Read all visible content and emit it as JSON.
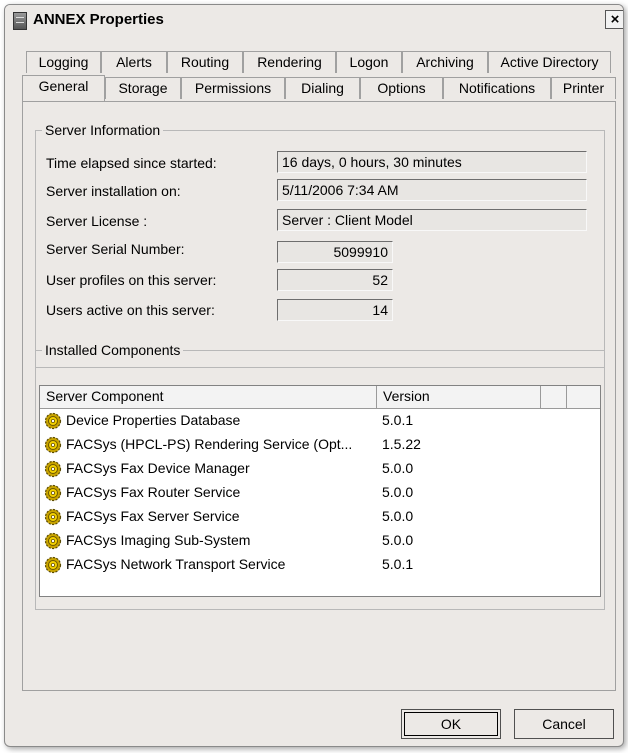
{
  "window": {
    "title": "ANNEX Properties",
    "close_glyph": "×"
  },
  "tabs_row1": [
    "Logging",
    "Alerts",
    "Routing",
    "Rendering",
    "Logon",
    "Archiving",
    "Active Directory"
  ],
  "tabs_row2": [
    "General",
    "Storage",
    "Permissions",
    "Dialing",
    "Options",
    "Notifications",
    "Printer"
  ],
  "active_tab": "General",
  "server_info": {
    "title": "Server Information",
    "time_elapsed_label": "Time elapsed since started:",
    "time_elapsed_value": "16 days, 0 hours, 30 minutes",
    "installation_label": "Server installation on:",
    "installation_value": "5/11/2006 7:34 AM",
    "license_label": "Server License :",
    "license_value": "Server : Client Model",
    "serial_label": "Server Serial Number:",
    "serial_value": "5099910",
    "profiles_label": "User profiles on this server:",
    "profiles_value": "52",
    "active_label": "Users active on this server:",
    "active_value": "14"
  },
  "components": {
    "title": "Installed Components",
    "col_component": "Server Component",
    "col_version": "Version",
    "rows": [
      {
        "name": "Device Properties Database",
        "version": "5.0.1",
        "icon": "gear-icon"
      },
      {
        "name": "FACSys (HPCL-PS) Rendering Service (Opt...",
        "version": "1.5.22",
        "icon": "gear-icon"
      },
      {
        "name": "FACSys Fax Device Manager",
        "version": "5.0.0",
        "icon": "gear-icon"
      },
      {
        "name": "FACSys Fax Router Service",
        "version": "5.0.0",
        "icon": "gear-icon"
      },
      {
        "name": "FACSys Fax Server Service",
        "version": "5.0.0",
        "icon": "gear-icon"
      },
      {
        "name": "FACSys Imaging Sub-System",
        "version": "5.0.0",
        "icon": "gear-icon"
      },
      {
        "name": "FACSys Network Transport Service",
        "version": "5.0.1",
        "icon": "gear-icon"
      }
    ]
  },
  "buttons": {
    "ok": "OK",
    "cancel": "Cancel"
  }
}
